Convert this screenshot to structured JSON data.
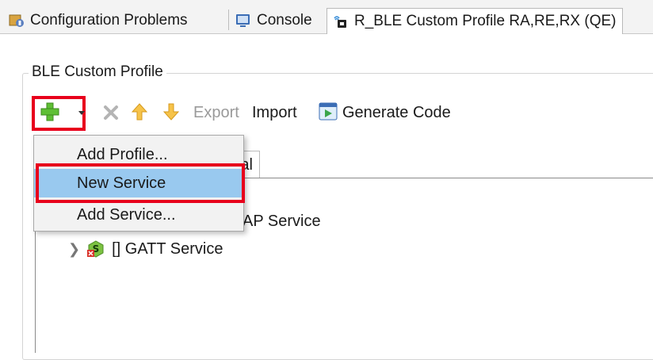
{
  "tabs": [
    {
      "label": "Configuration Problems",
      "icon": "configuration-problems-icon"
    },
    {
      "label": "Console",
      "icon": "console-icon"
    },
    {
      "label": "R_BLE Custom Profile RA,RE,RX (QE)",
      "icon": "qe-ble-icon",
      "active": true
    }
  ],
  "group": {
    "title": "BLE Custom Profile"
  },
  "toolbar": {
    "add_icon": "plus-icon",
    "dropdown_icon": "chevron-down-icon",
    "delete_icon": "delete-x-icon",
    "up_icon": "arrow-up-icon",
    "down_icon": "arrow-down-icon",
    "export_label": "Export",
    "import_label": "Import",
    "generate_label": "Generate Code",
    "generate_icon": "generate-code-icon"
  },
  "subtab": {
    "label_fragment": "al"
  },
  "tree": [
    {
      "label_fragment": "AP Service"
    },
    {
      "label": "[] GATT Service",
      "icon": "service-s-icon"
    }
  ],
  "menu": {
    "items": [
      {
        "label": "Add Profile..."
      },
      {
        "label": "New Service",
        "selected": true
      },
      {
        "label": "Add Service..."
      }
    ]
  },
  "colors": {
    "highlight": "#e8001c",
    "selection": "#99c9ef",
    "add_green": "#4caf2a",
    "arrow_yellow": "#f2b53a"
  }
}
